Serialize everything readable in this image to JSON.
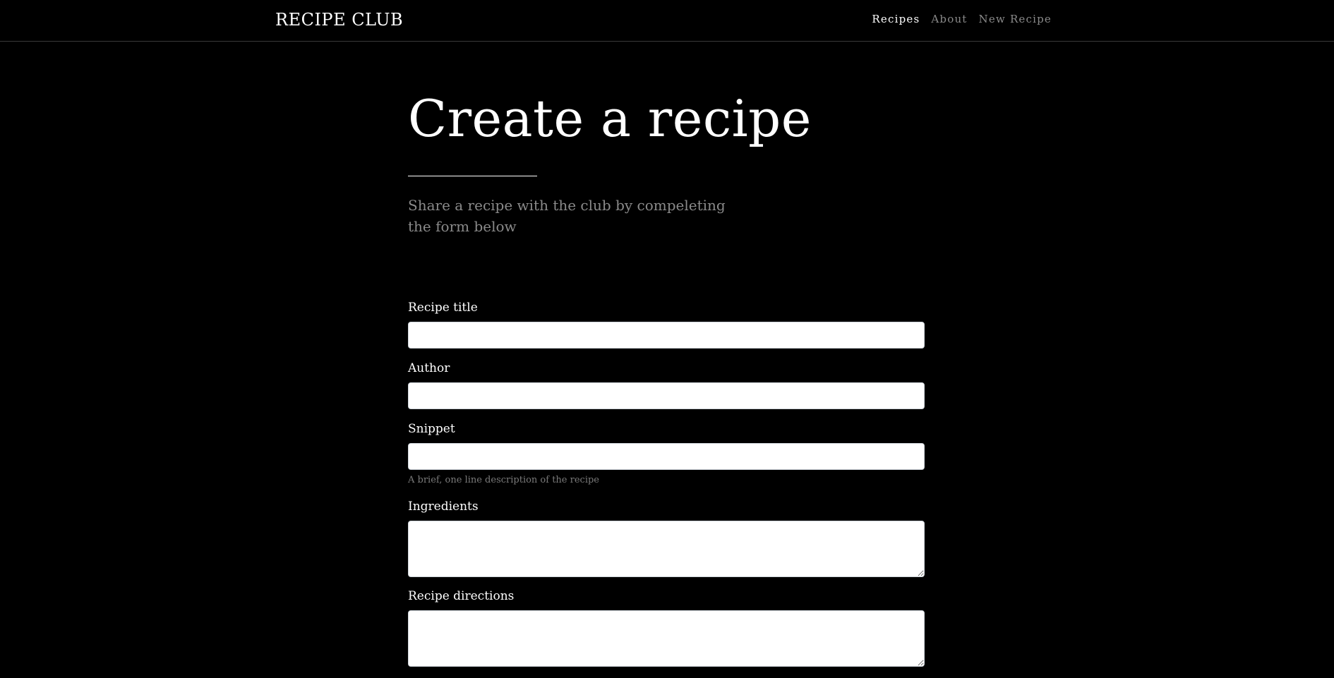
{
  "navbar": {
    "brand": "RECIPE CLUB",
    "links": [
      {
        "label": "Recipes",
        "active": true
      },
      {
        "label": "About",
        "active": false
      },
      {
        "label": "New Recipe",
        "active": false
      }
    ]
  },
  "header": {
    "title": "Create a recipe",
    "subtitle": "Share a recipe with the club by compeleting the form below"
  },
  "form": {
    "recipe_title": {
      "label": "Recipe title",
      "value": ""
    },
    "author": {
      "label": "Author",
      "value": ""
    },
    "snippet": {
      "label": "Snippet",
      "value": "",
      "help": "A brief, one line description of the recipe"
    },
    "ingredients": {
      "label": "Ingredients",
      "value": ""
    },
    "directions": {
      "label": "Recipe directions",
      "value": ""
    }
  },
  "colors": {
    "background": "#000000",
    "text": "#ffffff",
    "muted": "#8a8a8a",
    "input_bg": "#ffffff"
  }
}
